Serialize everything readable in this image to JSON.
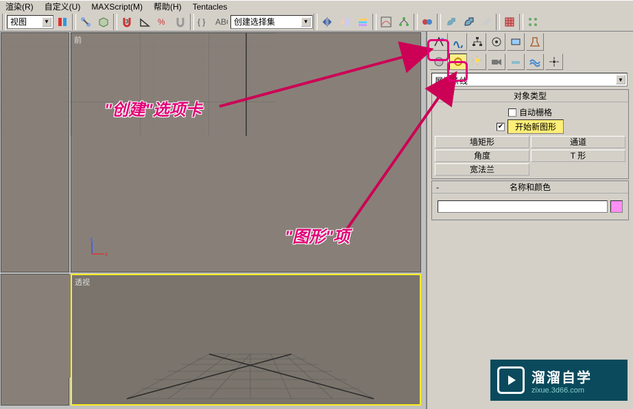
{
  "menu": {
    "render": "渲染(R)",
    "customize": "自定义(U)",
    "maxscript": "MAXScript(M)",
    "help": "帮助(H)",
    "tentacles": "Tentacles"
  },
  "toolbar": {
    "view_dd": "视图",
    "selection_set_dd": "创建选择集"
  },
  "viewports": {
    "front_label": "前",
    "perspective_label": "透视",
    "axis_x": "x",
    "axis_z": "z"
  },
  "cmdpanel": {
    "category_dd": "展样条线",
    "rollout_object_type": "对象类型",
    "auto_grid": "自动栅格",
    "start_new_shape": "开始新图形",
    "btn_wall_rect": "墙矩形",
    "btn_channel": "通道",
    "btn_angle": "角度",
    "btn_tee": "T 形",
    "btn_wide_flange": "宽法兰",
    "rollout_name_color": "名称和颜色"
  },
  "annotations": {
    "create_tab": "\"创建\"选项卡",
    "shapes_item": "\"图形\"项"
  },
  "watermark": {
    "title": "溜溜自学",
    "sub": "zixue.3d66.com"
  }
}
